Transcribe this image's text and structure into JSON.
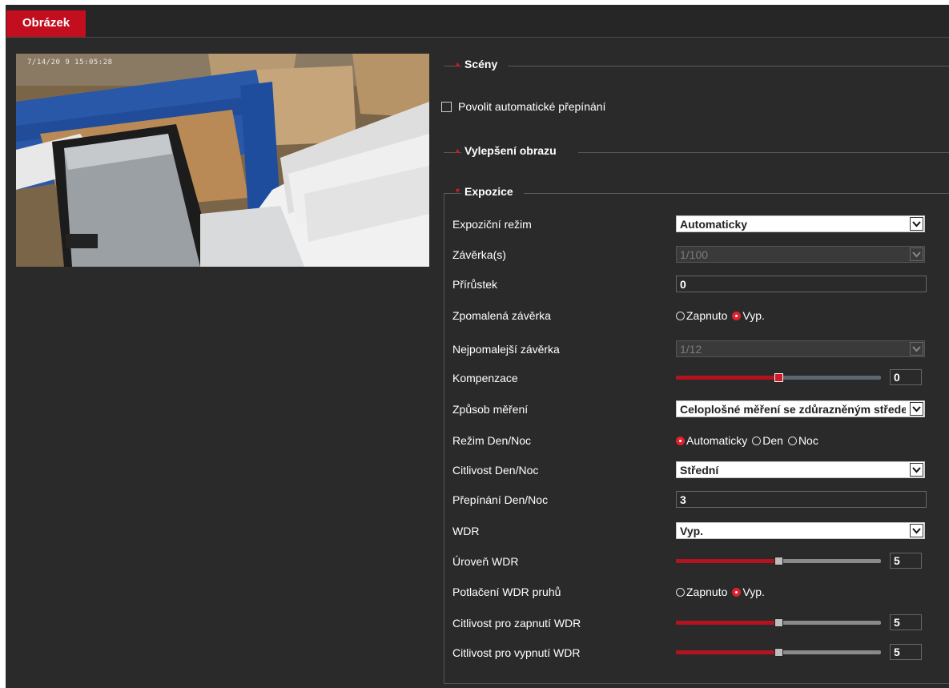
{
  "tab": {
    "label": "Obrázek"
  },
  "preview": {
    "timestamp": "7/14/20 9 15:05:28"
  },
  "sections": {
    "scenes": "Scény",
    "enhance": "Vylepšení obrazu",
    "exposure": "Expozice"
  },
  "auto_switch": {
    "label": "Povolit automatické přepínání",
    "checked": false
  },
  "rows": {
    "exposure_mode": {
      "label": "Expoziční režim",
      "value": "Automaticky"
    },
    "shutter": {
      "label": "Závěrka(s)",
      "value": "1/100"
    },
    "gain": {
      "label": "Přírůstek",
      "value": "0"
    },
    "slow_shutter": {
      "label": "Zpomalená závěrka",
      "opt_on": "Zapnuto",
      "opt_off": "Vyp.",
      "selected": "Vyp."
    },
    "slowest_shutter": {
      "label": "Nejpomalejší závěrka",
      "value": "1/12"
    },
    "compensation": {
      "label": "Kompenzace",
      "value": "0",
      "level": 0.5
    },
    "metering": {
      "label": "Způsob měření",
      "value": "Celoplošné měření se zdůrazněným středem"
    },
    "daynight_mode": {
      "label": "Režim Den/Noc",
      "opt_auto": "Automaticky",
      "opt_day": "Den",
      "opt_night": "Noc",
      "selected": "Automaticky"
    },
    "daynight_sens": {
      "label": "Citlivost Den/Noc",
      "value": "Střední"
    },
    "daynight_switch": {
      "label": "Přepínání Den/Noc",
      "value": "3"
    },
    "wdr": {
      "label": "WDR",
      "value": "Vyp."
    },
    "wdr_level": {
      "label": "Úroveň WDR",
      "value": "5",
      "level": 0.5
    },
    "wdr_stripe": {
      "label": "Potlačení WDR pruhů",
      "opt_on": "Zapnuto",
      "opt_off": "Vyp.",
      "selected": "Vyp."
    },
    "wdr_on_sens": {
      "label": "Citlivost pro zapnutí WDR",
      "value": "5",
      "level": 0.5
    },
    "wdr_off_sens": {
      "label": "Citlivost pro vypnutí WDR",
      "value": "5",
      "level": 0.5
    }
  },
  "colors": {
    "accent": "#c20e1f",
    "panel": "#2a2a2a"
  }
}
